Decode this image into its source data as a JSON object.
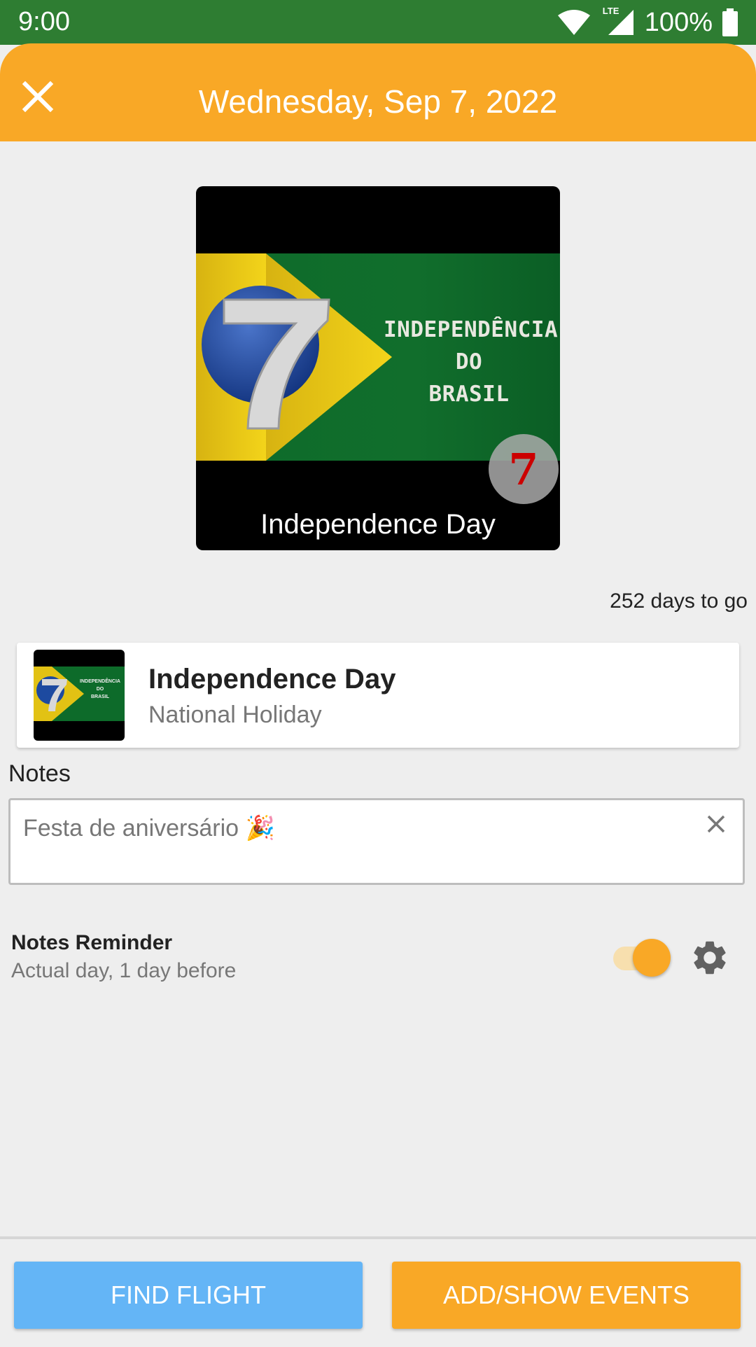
{
  "status_bar": {
    "time": "9:00",
    "network": "LTE",
    "battery": "100%",
    "color": "#2e7d32"
  },
  "app_bar": {
    "title": "Wednesday, Sep 7, 2022",
    "close_icon": "close-icon",
    "color": "#f9a826"
  },
  "hero": {
    "flag_text_line1": "INDEPENDÊNCIA",
    "flag_text_line2": "DO",
    "flag_text_line3": "BRASIL",
    "badge": "7",
    "caption": "Independence Day"
  },
  "countdown": "252 days to go",
  "event": {
    "thumb_text_line1": "INDEPENDÊNCIA",
    "thumb_text_line2": "DO",
    "thumb_text_line3": "BRASIL",
    "title": "Independence Day",
    "subtitle": "National Holiday"
  },
  "notes": {
    "label": "Notes",
    "value": "Festa de aniversário 🎉"
  },
  "reminder": {
    "title": "Notes Reminder",
    "subtitle": "Actual day, 1 day before",
    "enabled": true
  },
  "buttons": {
    "find_flight": "FIND FLIGHT",
    "add_show_events": "ADD/SHOW EVENTS",
    "find_flight_color": "#64b5f6",
    "add_show_events_color": "#f9a826"
  }
}
